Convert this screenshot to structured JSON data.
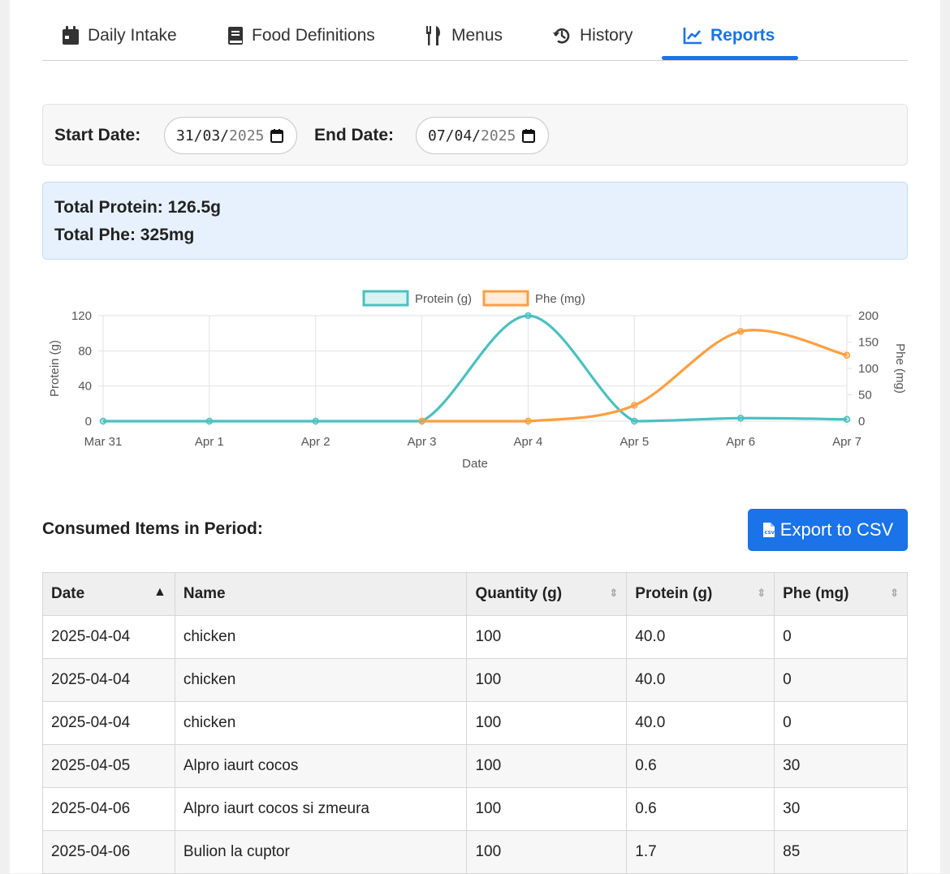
{
  "tabs": [
    {
      "label": "Daily Intake",
      "icon": "calendar-icon"
    },
    {
      "label": "Food Definitions",
      "icon": "book-icon"
    },
    {
      "label": "Menus",
      "icon": "utensils-icon"
    },
    {
      "label": "History",
      "icon": "history-icon"
    },
    {
      "label": "Reports",
      "icon": "chart-line-icon",
      "active": true
    }
  ],
  "filters": {
    "start_label": "Start Date:",
    "start_value_dm": "31/03/",
    "start_value_y": "2025",
    "end_label": "End Date:",
    "end_value_dm": "07/04/",
    "end_value_y": "2025"
  },
  "totals": {
    "protein": "Total Protein: 126.5g",
    "phe": "Total Phe: 325mg"
  },
  "chart_data": {
    "type": "line",
    "x": [
      "Mar 31",
      "Apr 1",
      "Apr 2",
      "Apr 3",
      "Apr 4",
      "Apr 5",
      "Apr 6",
      "Apr 7"
    ],
    "xlabel": "Date",
    "series": [
      {
        "name": "Protein (g)",
        "axis": "left",
        "color": "#4bc0c0",
        "values": [
          0,
          0,
          0,
          0,
          120,
          0,
          3.4,
          2.1
        ]
      },
      {
        "name": "Phe (mg)",
        "axis": "right",
        "color": "#ff9f40",
        "values": [
          null,
          null,
          null,
          0,
          0,
          30,
          170,
          125
        ]
      }
    ],
    "y_left": {
      "label": "Protein (g)",
      "ticks": [
        0,
        40,
        80,
        120
      ],
      "range": [
        0,
        120
      ]
    },
    "y_right": {
      "label": "Phe (mg)",
      "ticks": [
        0,
        50,
        100,
        150,
        200
      ],
      "range": [
        0,
        200
      ]
    },
    "grid": true,
    "legend": "top-center"
  },
  "items": {
    "title": "Consumed Items in Period:",
    "export_label": "Export to CSV",
    "columns": [
      "Date",
      "Name",
      "Quantity (g)",
      "Protein (g)",
      "Phe (mg)"
    ],
    "rows": [
      [
        "2025-04-04",
        "chicken",
        "100",
        "40.0",
        "0"
      ],
      [
        "2025-04-04",
        "chicken",
        "100",
        "40.0",
        "0"
      ],
      [
        "2025-04-04",
        "chicken",
        "100",
        "40.0",
        "0"
      ],
      [
        "2025-04-05",
        "Alpro iaurt cocos",
        "100",
        "0.6",
        "30"
      ],
      [
        "2025-04-06",
        "Alpro iaurt cocos si zmeura",
        "100",
        "0.6",
        "30"
      ],
      [
        "2025-04-06",
        "Bulion la cuptor",
        "100",
        "1.7",
        "85"
      ]
    ]
  },
  "colors": {
    "accent": "#1a73e8",
    "protein": "#4bc0c0",
    "phe": "#ff9f40"
  }
}
